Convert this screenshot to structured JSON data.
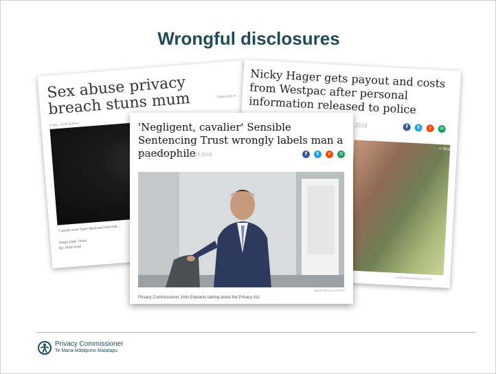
{
  "slide": {
    "title": "Wrongful disclosures"
  },
  "articles": {
    "left": {
      "headline": "Sex abuse privacy breach stuns mum",
      "subscribe": "Subscribe to ...",
      "edition": "8 Mar, 2019 Edition",
      "caption": "\"I would never have disclosed informati...",
      "source_1": "Otago Daily Times",
      "source_2": "By: Robb Kidd"
    },
    "right": {
      "headline": "Nicky Hager gets payout and costs from Westpac after personal information released to police",
      "date": "2019",
      "share_link": "< Share",
      "credit": "CAMERON BURNELL/STUFF"
    },
    "front": {
      "headline": "'Negligent, cavalier' Sensible Sentencing Trust wrongly labels man a paedophile",
      "byline": "Michael Daly • 21:50, Dec 19 2018",
      "credit": "MAARTEN HOLL/STUFF",
      "caption": "Privacy Commissioner John Edwards talking about the Privacy Act."
    }
  },
  "share_icons": [
    {
      "name": "facebook-icon",
      "glyph": "f",
      "color": "#3b5998"
    },
    {
      "name": "twitter-icon",
      "glyph": "t",
      "color": "#1da1f2"
    },
    {
      "name": "reddit-icon",
      "glyph": "r",
      "color": "#ff4500"
    },
    {
      "name": "email-icon",
      "glyph": "✉",
      "color": "#0f9d58"
    }
  ],
  "footer": {
    "org_name": "Privacy Commissioner",
    "org_sub": "Te Mana Mātāpono Matatapu",
    "accent": "#1f4b57"
  }
}
